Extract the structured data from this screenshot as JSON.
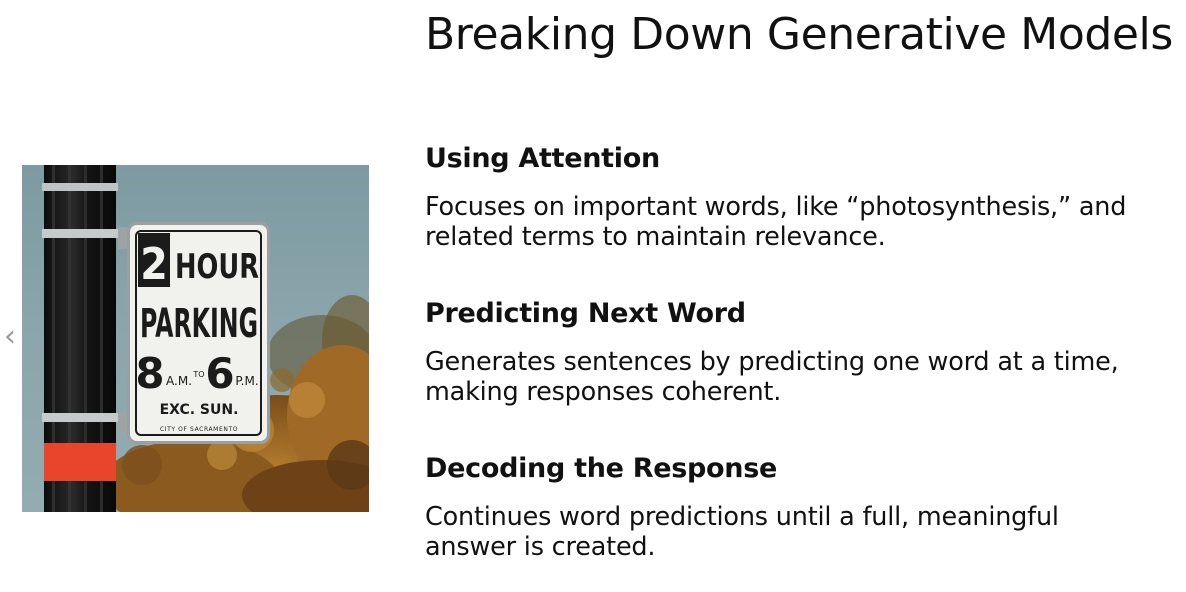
{
  "slide": {
    "title": "Breaking Down Generative Models",
    "nav": {
      "prev_icon": "chevron-left-icon",
      "prev_glyph": "‹"
    },
    "sections": [
      {
        "heading": "Using Attention",
        "body": "Focuses on important words, like “photosynthesis,” and related terms to maintain relevance."
      },
      {
        "heading": "Predicting Next Word",
        "body": "Generates sentences by predicting one word at a time, making responses coherent."
      },
      {
        "heading": "Decoding the Response",
        "body": "Continues word predictions until a full, meaningful answer is created."
      }
    ],
    "image": {
      "sign": {
        "number": "2",
        "unit": "HOUR",
        "line2": "PARKING",
        "from_hour": "8",
        "from_ampm": "A.M.",
        "to_word": "TO",
        "to_hour": "6",
        "to_ampm": "P.M.",
        "exception": "EXC. SUN.",
        "city": "CITY OF SACRAMENTO"
      }
    }
  },
  "colors": {
    "text": "#111111",
    "sky": "#8aa5ab",
    "foliage": "#9a6422",
    "pole": "#161616",
    "reflector": "#e8452a",
    "sign_bg": "#f1f1ee",
    "sign_text": "#1b1b1b"
  }
}
